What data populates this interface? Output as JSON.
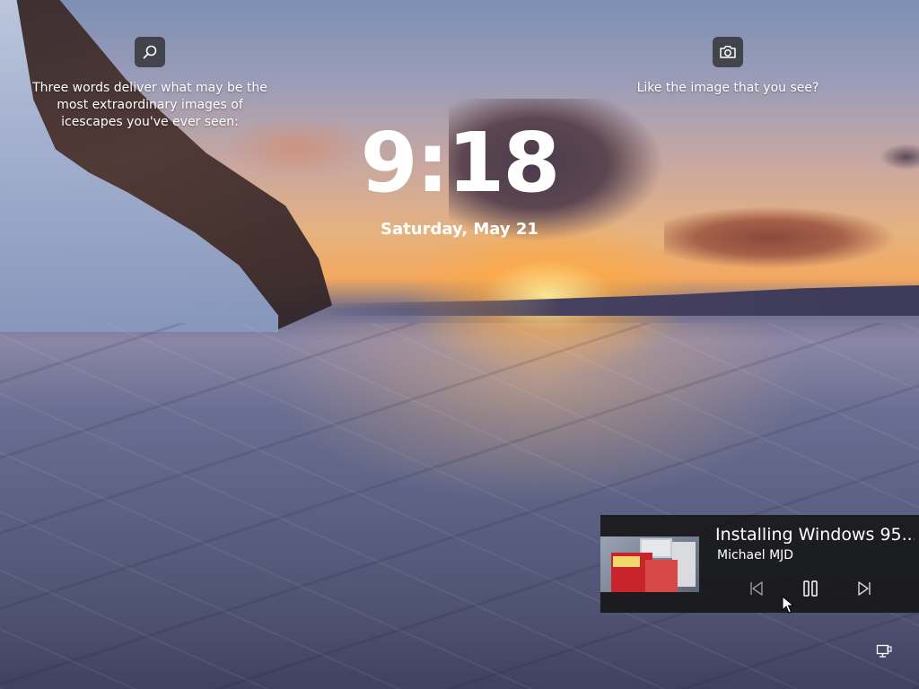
{
  "spotlight": {
    "left_text": "Three words deliver what may be the most extraordinary images of icescapes you've ever seen:",
    "right_text": "Like the image that you see?",
    "search_icon": "search-icon",
    "camera_icon": "camera-icon"
  },
  "clock": {
    "time": "9:18",
    "date": "Saturday, May 21"
  },
  "media": {
    "title": "Installing Windows 95...",
    "artist": "Michael MJD",
    "controls": [
      "previous-track-icon",
      "pause-icon",
      "next-track-icon"
    ]
  },
  "system": {
    "network_icon": "network-icon"
  },
  "colors": {
    "panel_bg": "#141414",
    "text": "#ffffff"
  }
}
